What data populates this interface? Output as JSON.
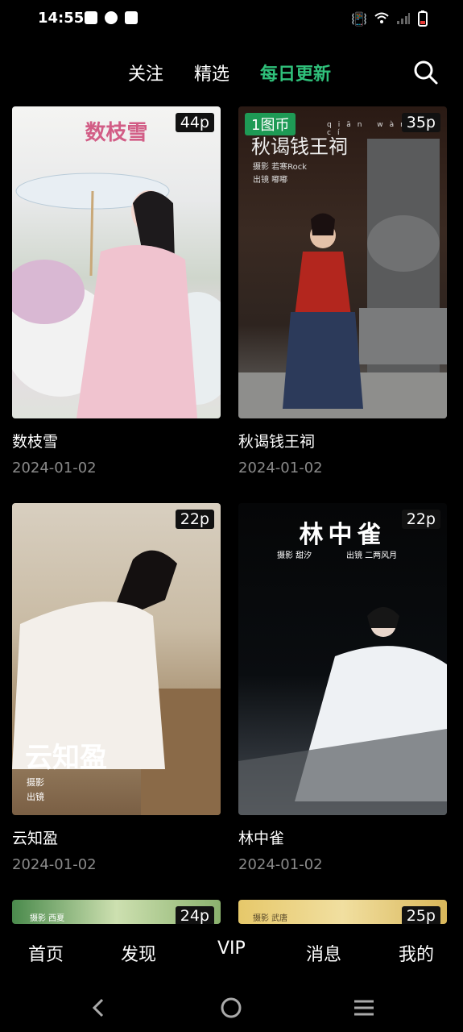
{
  "status": {
    "time": "14:55"
  },
  "tabs": {
    "follow": "关注",
    "featured": "精选",
    "daily": "每日更新"
  },
  "cards": [
    {
      "title": "数枝雪",
      "date": "2024-01-02",
      "count": "44p",
      "overlay": "数枝雪"
    },
    {
      "title": "秋谒钱王祠",
      "date": "2024-01-02",
      "count": "35p",
      "coin": "1图币",
      "overlay": "秋谒钱王祠",
      "pinyin": "qiān wàng cí",
      "credits": [
        "摄影 若寒Rock",
        "出镜 嘟嘟"
      ]
    },
    {
      "title": "云知盈",
      "date": "2024-01-02",
      "count": "22p",
      "overlay": "云知盈",
      "credits": [
        "摄影",
        "出镜"
      ]
    },
    {
      "title": "林中雀",
      "date": "2024-01-02",
      "count": "22p",
      "overlay": "林中雀",
      "credits": [
        "摄影 甜汐",
        "出镜 二两风月"
      ]
    },
    {
      "count": "24p",
      "credit": "摄影 西夏"
    },
    {
      "count": "25p",
      "credit": "摄影 武唐"
    }
  ],
  "nav": {
    "home": "首页",
    "discover": "发现",
    "vip": "VIP",
    "messages": "消息",
    "mine": "我的"
  },
  "colors": {
    "accent": "#2fc07a",
    "coin_bg": "#1e9a55",
    "date": "#8a8a8a"
  }
}
